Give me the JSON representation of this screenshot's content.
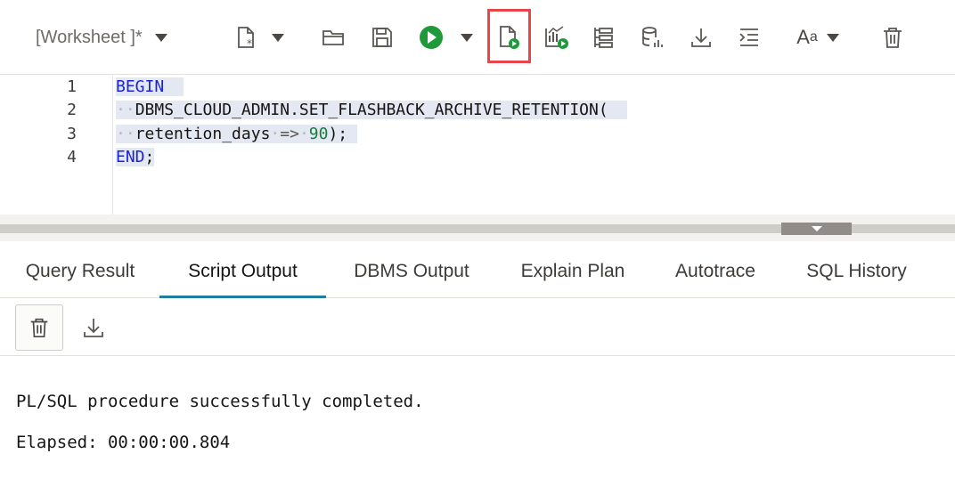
{
  "toolbar": {
    "worksheet_label": "[Worksheet ]*",
    "icons": [
      "new-file-icon",
      "open-folder-icon",
      "save-icon",
      "run-statement-icon",
      "run-script-icon",
      "explain-plan-icon",
      "autotrace-icon",
      "database-icon",
      "download-icon",
      "format-icon",
      "font-size-icon",
      "clear-icon"
    ]
  },
  "editor": {
    "line_numbers": [
      "1",
      "2",
      "3",
      "4"
    ],
    "lines": {
      "l1_kw": "BEGIN",
      "l2_fn": "DBMS_CLOUD_ADMIN.SET_FLASHBACK_ARCHIVE_RETENTION(",
      "l3_param": "retention_days",
      "l3_arrow": "=>",
      "l3_num": "90",
      "l3_end": ");",
      "l4_kw": "END",
      "l4_end": ";"
    }
  },
  "tabs": [
    "Query Result",
    "Script Output",
    "DBMS Output",
    "Explain Plan",
    "Autotrace",
    "SQL History"
  ],
  "active_tab": "Script Output",
  "output": {
    "line1": "PL/SQL procedure successfully completed.",
    "line2": "Elapsed: 00:00:00.804"
  },
  "colors": {
    "keyword": "#1a23d6",
    "number": "#1a7a3c",
    "run_green": "#1f9a3a",
    "highlight_red": "#e8464a",
    "active_tab_underline": "#227e9e"
  }
}
